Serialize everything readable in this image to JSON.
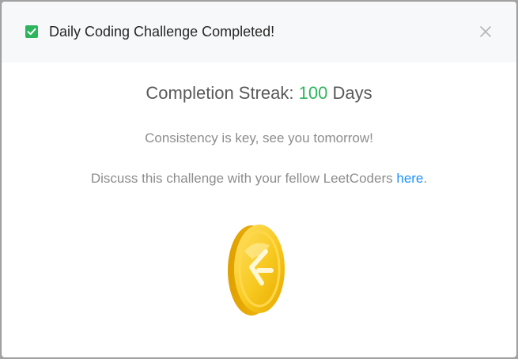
{
  "header": {
    "title": "Daily Coding Challenge Completed!",
    "checkbox_checked": true,
    "check_color": "#2db55d"
  },
  "close_icon": "close-icon",
  "body": {
    "streak_label": "Completion Streak:",
    "streak_value": "100",
    "streak_unit": "Days",
    "message": "Consistency is key, see you tomorrow!",
    "discuss_text": "Discuss this challenge with your fellow LeetCoders",
    "discuss_link": "here",
    "discuss_suffix": "."
  },
  "colors": {
    "accent_green": "#2db55d",
    "link_blue": "#1a90ff",
    "coin_gold": "#f5c518"
  },
  "coin_icon": "leetcode-coin-icon"
}
